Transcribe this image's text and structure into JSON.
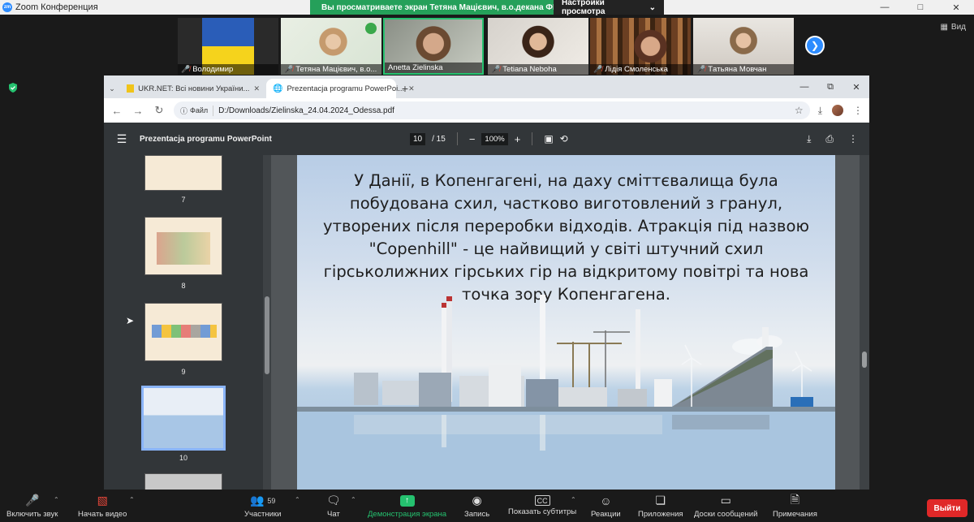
{
  "zoom": {
    "app_title": "Zoom Конференция",
    "share_banner": "Вы просматриваете экран Тетяна Мацієвич, в.о.декана ФЕ...",
    "view_options": "Настройки просмотра",
    "view_button": "Вид"
  },
  "participants": [
    {
      "name": "Володимир",
      "muted": true
    },
    {
      "name": "Тетяна Мацієвич, в.о...",
      "muted": true
    },
    {
      "name": "Anetta Zielinska",
      "muted": false
    },
    {
      "name": "Tetiana Neboha",
      "muted": true
    },
    {
      "name": "Лідія Смоленська",
      "muted": true
    },
    {
      "name": "Тaтьяна Мовчан",
      "muted": true
    }
  ],
  "browser": {
    "tabs": [
      {
        "label": "UKR.NET: Всі новини України...",
        "active": false
      },
      {
        "label": "Prezentacja programu PowerPoi...",
        "active": true
      }
    ],
    "address_chip": "Файл",
    "url": "D:/Downloads/Zielinska_24.04.2024_Odessa.pdf"
  },
  "pdf": {
    "title": "Prezentacja programu PowerPoint",
    "current_page": "10",
    "total_pages": "/ 15",
    "zoom": "100%",
    "thumbnails": [
      {
        "num": "7"
      },
      {
        "num": "8"
      },
      {
        "num": "9"
      },
      {
        "num": "10"
      }
    ],
    "slide_text": "У Данії, в Копенгагені, на даху сміттєвалища була побудована схил, частково виготовлений з гранул, утворених після переробки відходів. Атракція під назвою \"Copenhill\" - це найвищий у світі штучний схил гірськолижних гірських гір на відкритому повітрі та нова точка зору Копенгагена."
  },
  "toolbar": {
    "audio": "Включить звук",
    "video": "Начать видео",
    "participants": "Участники",
    "participants_count": "59",
    "chat": "Чат",
    "share": "Демонстрация экрана",
    "record": "Запись",
    "captions": "Показать субтитры",
    "reactions": "Реакции",
    "apps": "Приложения",
    "whiteboards": "Доски сообщений",
    "notes": "Примечания",
    "leave": "Выйти"
  },
  "colors": {
    "zoom_blue": "#2d8cff",
    "share_green": "#25a05a",
    "leave_red": "#e02828"
  }
}
